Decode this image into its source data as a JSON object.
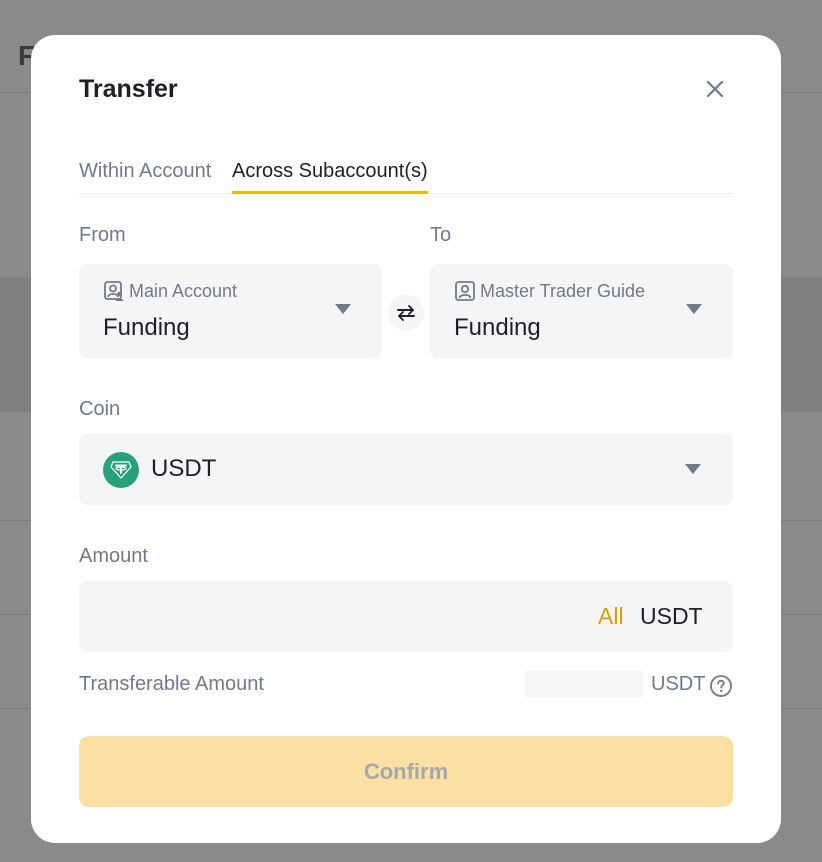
{
  "background": {
    "title_fragment": "F"
  },
  "modal": {
    "title": "Transfer"
  },
  "tabs": [
    {
      "label": "Within Account",
      "active": false
    },
    {
      "label": "Across Subaccount(s)",
      "active": true
    }
  ],
  "from": {
    "label": "From",
    "account": "Main Account",
    "wallet": "Funding"
  },
  "to": {
    "label": "To",
    "account": "Master Trader Guide",
    "wallet": "Funding"
  },
  "coin": {
    "label": "Coin",
    "symbol": "USDT",
    "icon_color": "#26a17b"
  },
  "amount": {
    "label": "Amount",
    "value": "",
    "all_label": "All",
    "unit": "USDT"
  },
  "transferable": {
    "label": "Transferable Amount",
    "unit": "USDT"
  },
  "confirm": {
    "label": "Confirm",
    "disabled": true
  },
  "colors": {
    "accent": "#f0b90b",
    "all_link": "#d89f00",
    "confirm_bg": "#fbdfa5",
    "field_bg": "#f4f5f7"
  },
  "icons": {
    "close": "close-icon",
    "from_account": "user-group-icon",
    "to_account": "user-icon",
    "swap": "swap-arrows-icon",
    "caret": "caret-down-icon",
    "coin": "tether-icon",
    "help": "question-circle-icon"
  }
}
